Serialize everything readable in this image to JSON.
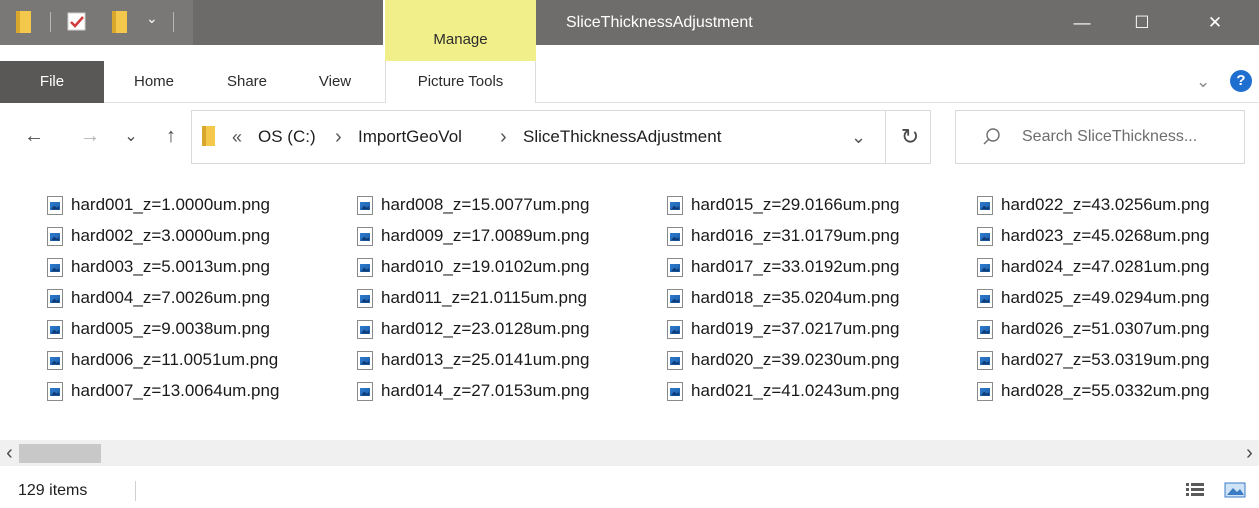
{
  "window": {
    "title": "SliceThicknessAdjustment",
    "manage_tab": "Manage",
    "controls": {
      "minimize": "—",
      "maximize": "☐",
      "close": "✕"
    }
  },
  "ribbon": {
    "tabs": [
      "File",
      "Home",
      "Share",
      "View",
      "Picture Tools"
    ],
    "collapse_icon": "chevron-down-icon",
    "help_icon": "help-icon",
    "help_label": "?"
  },
  "nav": {
    "back": "←",
    "forward": "→",
    "recent": "⌄",
    "up": "↑",
    "refresh": "↻",
    "dropdown": "⌄"
  },
  "address": {
    "overflow": "«",
    "segments": [
      "OS (C:)",
      "ImportGeoVol",
      "SliceThicknessAdjustment"
    ],
    "separator": "›"
  },
  "search": {
    "placeholder": "Search SliceThickness..."
  },
  "files": {
    "columns": [
      [
        "hard001_z=1.0000um.png",
        "hard002_z=3.0000um.png",
        "hard003_z=5.0013um.png",
        "hard004_z=7.0026um.png",
        "hard005_z=9.0038um.png",
        "hard006_z=11.0051um.png",
        "hard007_z=13.0064um.png"
      ],
      [
        "hard008_z=15.0077um.png",
        "hard009_z=17.0089um.png",
        "hard010_z=19.0102um.png",
        "hard011_z=21.0115um.png",
        "hard012_z=23.0128um.png",
        "hard013_z=25.0141um.png",
        "hard014_z=27.0153um.png"
      ],
      [
        "hard015_z=29.0166um.png",
        "hard016_z=31.0179um.png",
        "hard017_z=33.0192um.png",
        "hard018_z=35.0204um.png",
        "hard019_z=37.0217um.png",
        "hard020_z=39.0230um.png",
        "hard021_z=41.0243um.png"
      ],
      [
        "hard022_z=43.0256um.png",
        "hard023_z=45.0268um.png",
        "hard024_z=47.0281um.png",
        "hard025_z=49.0294um.png",
        "hard026_z=51.0307um.png",
        "hard027_z=53.0319um.png",
        "hard028_z=55.0332um.png"
      ]
    ]
  },
  "scrollbar": {
    "left": "‹",
    "right": "›"
  },
  "status": {
    "count": "129 items"
  },
  "colors": {
    "titlebar": "#6f6d6c",
    "manage_accent": "#f1ef8a",
    "file_tab": "#5a5856",
    "folder": "#f3c84b",
    "help": "#1e6fd0"
  }
}
